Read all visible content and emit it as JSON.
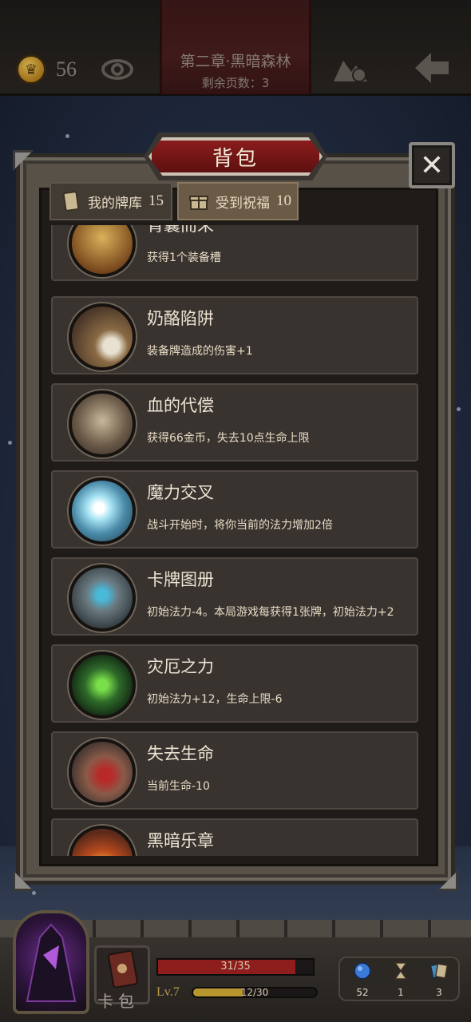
{
  "topbar": {
    "coin_icon": "crown-coin-icon",
    "coin_count": "56",
    "chapter_title": "第二章·黑暗森林",
    "pages_left": "剩余页数：3"
  },
  "panel": {
    "title": "背包",
    "close_icon": "close-icon",
    "tabs": [
      {
        "label": "我的牌库",
        "count": "15",
        "icon": "card-icon"
      },
      {
        "label": "受到祝福",
        "count": "10",
        "icon": "gift-icon",
        "active": true
      }
    ],
    "blessings": [
      {
        "title": "背囊而来",
        "desc": "获得1个装备槽",
        "art_color": "#8a5a2a"
      },
      {
        "title": "奶酪陷阱",
        "desc": "装备牌造成的伤害+1",
        "art_color": "#6a5848"
      },
      {
        "title": "血的代偿",
        "desc": "获得66金币，失去10点生命上限",
        "art_color": "#7a6a58"
      },
      {
        "title": "魔力交叉",
        "desc": "战斗开始时，将你当前的法力增加2倍",
        "art_color": "#5a8aa0"
      },
      {
        "title": "卡牌图册",
        "desc": "初始法力-4。本局游戏每获得1张牌，初始法力+2",
        "art_color": "#5a6a70"
      },
      {
        "title": "灾厄之力",
        "desc": "初始法力+12，生命上限-6",
        "art_color": "#2e5a2a"
      },
      {
        "title": "失去生命",
        "desc": "当前生命-10",
        "art_color": "#7a4a3a"
      },
      {
        "title": "黑暗乐章",
        "desc": "",
        "art_color": "#8a4a2a"
      }
    ]
  },
  "hud": {
    "deck_label": "卡包",
    "hp_text": "31/35",
    "hp_current": 31,
    "hp_max": 35,
    "level": "Lv.7",
    "xp_text": "12/30",
    "xp_current": 12,
    "xp_max": 30,
    "stats": [
      {
        "icon": "mana-orb-icon",
        "value": "52"
      },
      {
        "icon": "hourglass-icon",
        "value": "1"
      },
      {
        "icon": "cards-icon",
        "value": "3"
      }
    ]
  }
}
